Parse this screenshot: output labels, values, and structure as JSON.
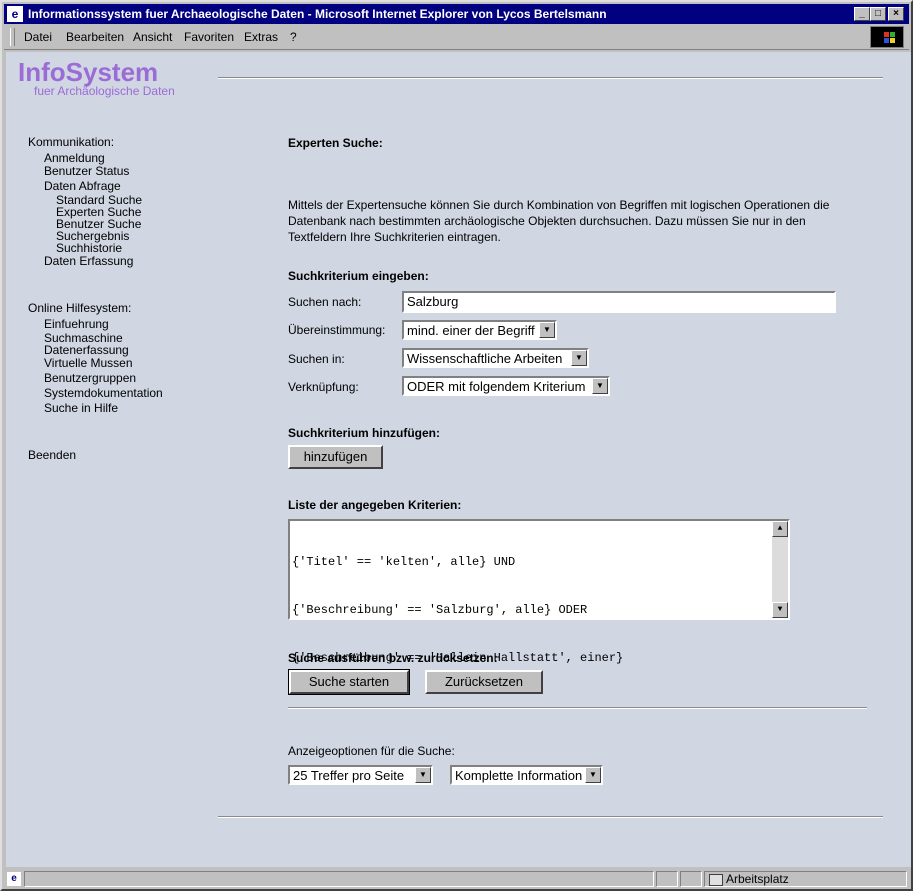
{
  "window": {
    "title": "Informationssystem fuer Archaeologische Daten - Microsoft Internet Explorer von Lycos Bertelsmann"
  },
  "menu": [
    "Datei",
    "Bearbeiten",
    "Ansicht",
    "Favoriten",
    "Extras",
    "?"
  ],
  "logo": {
    "title": "InfoSystem",
    "subtitle": "fuer Archäologische Daten"
  },
  "sidebar": {
    "kommunikation": "Kommunikation:",
    "anmeldung": "Anmeldung",
    "benutzer_status": "Benutzer Status",
    "daten_abfrage": "Daten Abfrage",
    "standard_suche": "Standard Suche",
    "experten_suche": "Experten Suche",
    "benutzer_suche": "Benutzer Suche",
    "suchergebnis": "Suchergebnis",
    "suchhistorie": "Suchhistorie",
    "daten_erfassung": "Daten Erfassung",
    "hilfe": "Online Hilfesystem:",
    "einfuehrung": "Einfuehrung",
    "suchmaschine": "Suchmaschine",
    "datenerfassung": "Datenerfassung",
    "virtuelle_mussen": "Virtuelle Mussen",
    "benutzergruppen": "Benutzergruppen",
    "systemdokumentation": "Systemdokumentation",
    "suche_in_hilfe": "Suche in Hilfe",
    "beenden": "Beenden"
  },
  "main": {
    "title": "Experten Suche:",
    "description": "Mittels der Expertensuche können Sie durch Kombination von Begriffen mit logischen Operationen die Datenbank nach bestimmten archäologische Objekten durchsuchen. Dazu müssen Sie nur in den Textfeldern Ihre Suchkriterien eintragen.",
    "criterion_heading": "Suchkriterium eingeben:",
    "search_for_label": "Suchen nach:",
    "search_for_value": "Salzburg",
    "match_label": "Übereinstimmung:",
    "match_value": "mind. einer der Begriff",
    "search_in_label": "Suchen in:",
    "search_in_value": "Wissenschaftliche Arbeiten",
    "link_label": "Verknüpfung:",
    "link_value": "ODER mit folgendem Kriterium",
    "add_heading": "Suchkriterium hinzufügen:",
    "add_button": "hinzufügen",
    "list_heading": "Liste der angegeben Kriterien:",
    "criteria": [
      "{'Titel' == 'kelten', alle} UND",
      "{'Beschreibung' == 'Salzburg', alle} ODER",
      "{'Beschreibung' == 'Hallein Hallstatt', einer}"
    ],
    "execute_heading": "Suche ausführen bzw. zurücksetzen:",
    "start_button": "Suche starten",
    "reset_button": "Zurücksetzen",
    "display_options_label": "Anzeigeoptionen für die Suche:",
    "hits_value": "25 Treffer pro Seite",
    "info_value": "Komplette Information"
  },
  "statusbar": {
    "zone": "Arbeitsplatz"
  }
}
